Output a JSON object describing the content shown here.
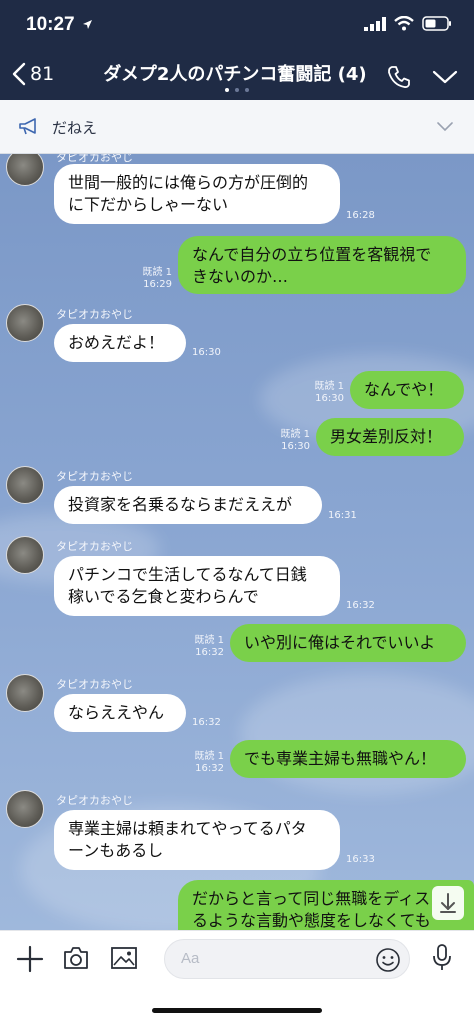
{
  "status": {
    "time": "10:27"
  },
  "header": {
    "back_count": "81",
    "title": "ダメプ2人のパチンコ奮闘記 (4)"
  },
  "announcement": {
    "text": "だねえ"
  },
  "messages": [
    {
      "side": "in",
      "sender": "タピオカおやじ",
      "lines": [
        "世間一般的には俺らの方が圧倒的",
        "に下だからしゃーない"
      ],
      "time": "16:28"
    },
    {
      "side": "out",
      "read": "既読 1",
      "lines": [
        "なんで自分の立ち位置を客観視で",
        "きないのか…"
      ],
      "time": "16:29"
    },
    {
      "side": "in",
      "sender": "タピオカおやじ",
      "lines": [
        "おめえだよ！"
      ],
      "time": "16:30"
    },
    {
      "side": "out",
      "read": "既読 1",
      "lines": [
        "なんでや！"
      ],
      "time": "16:30"
    },
    {
      "side": "out",
      "read": "既読 1",
      "lines": [
        "男女差別反対！"
      ],
      "time": "16:30"
    },
    {
      "side": "in",
      "sender": "タピオカおやじ",
      "lines": [
        "投資家を名乗るならまだええが"
      ],
      "time": "16:31"
    },
    {
      "side": "in",
      "sender": "タピオカおやじ",
      "lines": [
        "パチンコで生活してるなんて日銭",
        "稼いでる乞食と変わらんで"
      ],
      "time": "16:32"
    },
    {
      "side": "out",
      "read": "既読 1",
      "lines": [
        "いや別に俺はそれでいいよ"
      ],
      "time": "16:32"
    },
    {
      "side": "in",
      "sender": "タピオカおやじ",
      "lines": [
        "ならええやん"
      ],
      "time": "16:32"
    },
    {
      "side": "out",
      "read": "既読 1",
      "lines": [
        "でも専業主婦も無職やん！"
      ],
      "time": "16:32"
    },
    {
      "side": "in",
      "sender": "タピオカおやじ",
      "lines": [
        "専業主婦は頼まれてやってるパタ",
        "ーンもあるし"
      ],
      "time": "16:33"
    },
    {
      "side": "out",
      "read": "",
      "lines": [
        "だからと言って同じ無職をディス",
        "るような言動や態度をしなくても"
      ],
      "time": ""
    }
  ],
  "input": {
    "placeholder": "Aa"
  },
  "colors": {
    "nav_bg": "#1f2b45",
    "chat_bg": "#7b98c7",
    "outgoing": "#7ad04a",
    "incoming": "#ffffff"
  },
  "icons": [
    "location-arrow-icon",
    "signal-icon",
    "wifi-icon",
    "battery-icon",
    "back-chevron-icon",
    "phone-icon",
    "chevron-down-icon",
    "megaphone-icon",
    "plus-icon",
    "camera-icon",
    "image-icon",
    "emoji-icon",
    "microphone-icon",
    "scroll-down-icon"
  ]
}
